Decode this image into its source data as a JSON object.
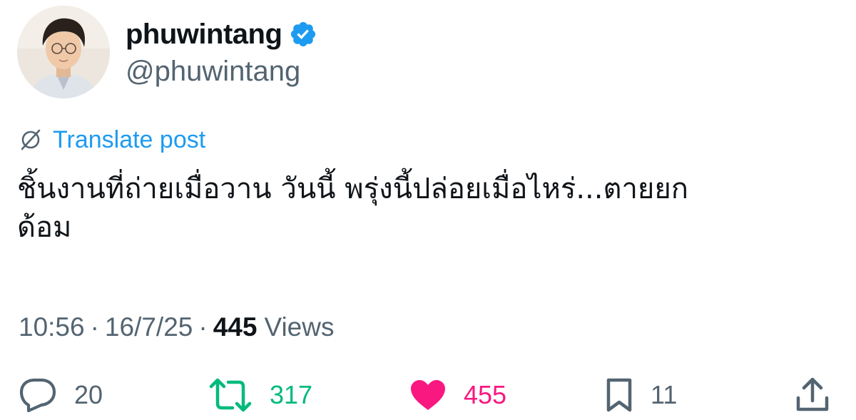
{
  "user": {
    "display_name": "phuwintang",
    "handle": "@phuwintang",
    "verified_badge_color": "#1d9bf0",
    "avatar_icon": "profile-photo"
  },
  "translate": {
    "label": "Translate post",
    "icon": "globe-icon",
    "color": "#1d9bf0"
  },
  "post": {
    "text_line1": "ชิ้นงานที่ถ่ายเมื่อวาน วันนี้ พรุ่งนี้ปล่อยเมื่อไหร่...ตายยก",
    "text_line2": "ด้อม"
  },
  "meta": {
    "time": "10:56",
    "date": "16/7/25",
    "views_count": "445",
    "views_label": "Views",
    "separator": "·"
  },
  "actions": {
    "reply": {
      "icon": "reply-icon",
      "count": "20"
    },
    "retweet": {
      "icon": "retweet-icon",
      "count": "317",
      "color": "#00ba7c"
    },
    "like": {
      "icon": "heart-icon",
      "count": "455",
      "color": "#f91880"
    },
    "bookmark": {
      "icon": "bookmark-icon",
      "count": "11"
    },
    "share": {
      "icon": "share-icon"
    }
  }
}
